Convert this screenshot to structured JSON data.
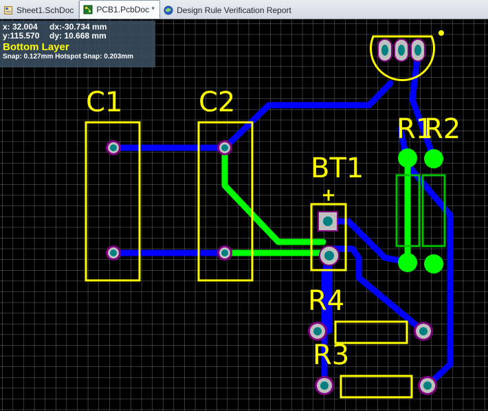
{
  "tabs": [
    {
      "label": "Sheet1.SchDoc",
      "icon": "schematic-doc-icon",
      "active": false
    },
    {
      "label": "PCB1.PcbDoc *",
      "icon": "pcb-doc-icon",
      "active": true
    },
    {
      "label": "Design Rule Verification Report",
      "icon": "report-doc-icon",
      "active": false
    }
  ],
  "hud": {
    "x": "x: 32.004",
    "dx": "dx:-30.734  mm",
    "y": "y:115.570",
    "dy": "dy: 10.668  mm",
    "layer": "Bottom Layer",
    "snap": "Snap: 0.127mm Hotspot Snap: 0.203mm"
  },
  "designators": {
    "c1": "C1",
    "c2": "C2",
    "bt1": "BT1",
    "bt1_polarity": "+",
    "r1": "R1",
    "r2": "R2",
    "r3": "R3",
    "r4": "R4"
  },
  "colors": {
    "background": "#000000",
    "grid": "#6e6e6e",
    "silkscreen": "#ffff00",
    "bottom_layer": "#0000ff",
    "top_layer": "#00ff00",
    "pad_ring": "#c0c0c0",
    "pad_hole": "#008080",
    "via_ring": "#800080"
  }
}
